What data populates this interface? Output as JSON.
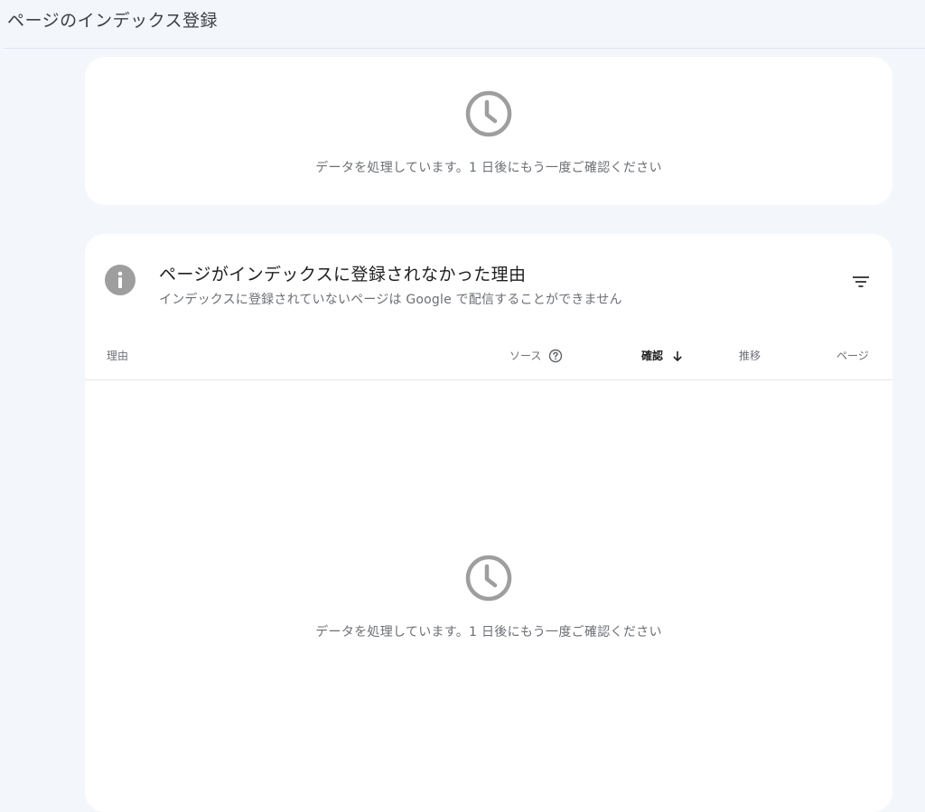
{
  "header": {
    "title": "ページのインデックス登録"
  },
  "status_card": {
    "icon": "clock-icon",
    "message": "データを処理しています。1 日後にもう一度ご確認ください"
  },
  "reasons_card": {
    "icon": "info-icon",
    "title": "ページがインデックスに登録されなかった理由",
    "subtitle": "インデックスに登録されていないページは Google で配信することができません",
    "filter_icon": "filter-icon",
    "columns": {
      "reason": "理由",
      "source": "ソース",
      "confirm": "確認",
      "trend": "推移",
      "pages": "ページ"
    },
    "empty_state": {
      "icon": "clock-icon",
      "message": "データを処理しています。1 日後にもう一度ご確認ください"
    }
  },
  "colors": {
    "background": "#f3f6fb",
    "card": "#ffffff",
    "icon_gray": "#9e9e9e",
    "muted_text": "#6b6f74"
  }
}
